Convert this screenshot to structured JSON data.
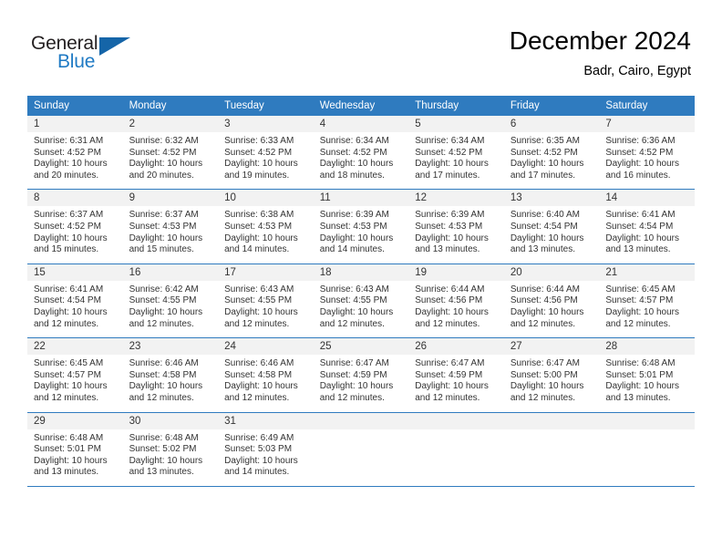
{
  "logo": {
    "word1": "General",
    "word2": "Blue",
    "triangle_color": "#1565a8",
    "blue_color": "#1f7ac4"
  },
  "header": {
    "title": "December 2024",
    "location": "Badr, Cairo, Egypt",
    "header_bg": "#2f7bbf"
  },
  "weekday_headers": [
    "Sunday",
    "Monday",
    "Tuesday",
    "Wednesday",
    "Thursday",
    "Friday",
    "Saturday"
  ],
  "weeks": [
    [
      {
        "day": "1",
        "sunrise": "Sunrise: 6:31 AM",
        "sunset": "Sunset: 4:52 PM",
        "daylight1": "Daylight: 10 hours",
        "daylight2": "and 20 minutes."
      },
      {
        "day": "2",
        "sunrise": "Sunrise: 6:32 AM",
        "sunset": "Sunset: 4:52 PM",
        "daylight1": "Daylight: 10 hours",
        "daylight2": "and 20 minutes."
      },
      {
        "day": "3",
        "sunrise": "Sunrise: 6:33 AM",
        "sunset": "Sunset: 4:52 PM",
        "daylight1": "Daylight: 10 hours",
        "daylight2": "and 19 minutes."
      },
      {
        "day": "4",
        "sunrise": "Sunrise: 6:34 AM",
        "sunset": "Sunset: 4:52 PM",
        "daylight1": "Daylight: 10 hours",
        "daylight2": "and 18 minutes."
      },
      {
        "day": "5",
        "sunrise": "Sunrise: 6:34 AM",
        "sunset": "Sunset: 4:52 PM",
        "daylight1": "Daylight: 10 hours",
        "daylight2": "and 17 minutes."
      },
      {
        "day": "6",
        "sunrise": "Sunrise: 6:35 AM",
        "sunset": "Sunset: 4:52 PM",
        "daylight1": "Daylight: 10 hours",
        "daylight2": "and 17 minutes."
      },
      {
        "day": "7",
        "sunrise": "Sunrise: 6:36 AM",
        "sunset": "Sunset: 4:52 PM",
        "daylight1": "Daylight: 10 hours",
        "daylight2": "and 16 minutes."
      }
    ],
    [
      {
        "day": "8",
        "sunrise": "Sunrise: 6:37 AM",
        "sunset": "Sunset: 4:52 PM",
        "daylight1": "Daylight: 10 hours",
        "daylight2": "and 15 minutes."
      },
      {
        "day": "9",
        "sunrise": "Sunrise: 6:37 AM",
        "sunset": "Sunset: 4:53 PM",
        "daylight1": "Daylight: 10 hours",
        "daylight2": "and 15 minutes."
      },
      {
        "day": "10",
        "sunrise": "Sunrise: 6:38 AM",
        "sunset": "Sunset: 4:53 PM",
        "daylight1": "Daylight: 10 hours",
        "daylight2": "and 14 minutes."
      },
      {
        "day": "11",
        "sunrise": "Sunrise: 6:39 AM",
        "sunset": "Sunset: 4:53 PM",
        "daylight1": "Daylight: 10 hours",
        "daylight2": "and 14 minutes."
      },
      {
        "day": "12",
        "sunrise": "Sunrise: 6:39 AM",
        "sunset": "Sunset: 4:53 PM",
        "daylight1": "Daylight: 10 hours",
        "daylight2": "and 13 minutes."
      },
      {
        "day": "13",
        "sunrise": "Sunrise: 6:40 AM",
        "sunset": "Sunset: 4:54 PM",
        "daylight1": "Daylight: 10 hours",
        "daylight2": "and 13 minutes."
      },
      {
        "day": "14",
        "sunrise": "Sunrise: 6:41 AM",
        "sunset": "Sunset: 4:54 PM",
        "daylight1": "Daylight: 10 hours",
        "daylight2": "and 13 minutes."
      }
    ],
    [
      {
        "day": "15",
        "sunrise": "Sunrise: 6:41 AM",
        "sunset": "Sunset: 4:54 PM",
        "daylight1": "Daylight: 10 hours",
        "daylight2": "and 12 minutes."
      },
      {
        "day": "16",
        "sunrise": "Sunrise: 6:42 AM",
        "sunset": "Sunset: 4:55 PM",
        "daylight1": "Daylight: 10 hours",
        "daylight2": "and 12 minutes."
      },
      {
        "day": "17",
        "sunrise": "Sunrise: 6:43 AM",
        "sunset": "Sunset: 4:55 PM",
        "daylight1": "Daylight: 10 hours",
        "daylight2": "and 12 minutes."
      },
      {
        "day": "18",
        "sunrise": "Sunrise: 6:43 AM",
        "sunset": "Sunset: 4:55 PM",
        "daylight1": "Daylight: 10 hours",
        "daylight2": "and 12 minutes."
      },
      {
        "day": "19",
        "sunrise": "Sunrise: 6:44 AM",
        "sunset": "Sunset: 4:56 PM",
        "daylight1": "Daylight: 10 hours",
        "daylight2": "and 12 minutes."
      },
      {
        "day": "20",
        "sunrise": "Sunrise: 6:44 AM",
        "sunset": "Sunset: 4:56 PM",
        "daylight1": "Daylight: 10 hours",
        "daylight2": "and 12 minutes."
      },
      {
        "day": "21",
        "sunrise": "Sunrise: 6:45 AM",
        "sunset": "Sunset: 4:57 PM",
        "daylight1": "Daylight: 10 hours",
        "daylight2": "and 12 minutes."
      }
    ],
    [
      {
        "day": "22",
        "sunrise": "Sunrise: 6:45 AM",
        "sunset": "Sunset: 4:57 PM",
        "daylight1": "Daylight: 10 hours",
        "daylight2": "and 12 minutes."
      },
      {
        "day": "23",
        "sunrise": "Sunrise: 6:46 AM",
        "sunset": "Sunset: 4:58 PM",
        "daylight1": "Daylight: 10 hours",
        "daylight2": "and 12 minutes."
      },
      {
        "day": "24",
        "sunrise": "Sunrise: 6:46 AM",
        "sunset": "Sunset: 4:58 PM",
        "daylight1": "Daylight: 10 hours",
        "daylight2": "and 12 minutes."
      },
      {
        "day": "25",
        "sunrise": "Sunrise: 6:47 AM",
        "sunset": "Sunset: 4:59 PM",
        "daylight1": "Daylight: 10 hours",
        "daylight2": "and 12 minutes."
      },
      {
        "day": "26",
        "sunrise": "Sunrise: 6:47 AM",
        "sunset": "Sunset: 4:59 PM",
        "daylight1": "Daylight: 10 hours",
        "daylight2": "and 12 minutes."
      },
      {
        "day": "27",
        "sunrise": "Sunrise: 6:47 AM",
        "sunset": "Sunset: 5:00 PM",
        "daylight1": "Daylight: 10 hours",
        "daylight2": "and 12 minutes."
      },
      {
        "day": "28",
        "sunrise": "Sunrise: 6:48 AM",
        "sunset": "Sunset: 5:01 PM",
        "daylight1": "Daylight: 10 hours",
        "daylight2": "and 13 minutes."
      }
    ],
    [
      {
        "day": "29",
        "sunrise": "Sunrise: 6:48 AM",
        "sunset": "Sunset: 5:01 PM",
        "daylight1": "Daylight: 10 hours",
        "daylight2": "and 13 minutes."
      },
      {
        "day": "30",
        "sunrise": "Sunrise: 6:48 AM",
        "sunset": "Sunset: 5:02 PM",
        "daylight1": "Daylight: 10 hours",
        "daylight2": "and 13 minutes."
      },
      {
        "day": "31",
        "sunrise": "Sunrise: 6:49 AM",
        "sunset": "Sunset: 5:03 PM",
        "daylight1": "Daylight: 10 hours",
        "daylight2": "and 14 minutes."
      },
      {
        "day": "",
        "sunrise": "",
        "sunset": "",
        "daylight1": "",
        "daylight2": ""
      },
      {
        "day": "",
        "sunrise": "",
        "sunset": "",
        "daylight1": "",
        "daylight2": ""
      },
      {
        "day": "",
        "sunrise": "",
        "sunset": "",
        "daylight1": "",
        "daylight2": ""
      },
      {
        "day": "",
        "sunrise": "",
        "sunset": "",
        "daylight1": "",
        "daylight2": ""
      }
    ]
  ]
}
